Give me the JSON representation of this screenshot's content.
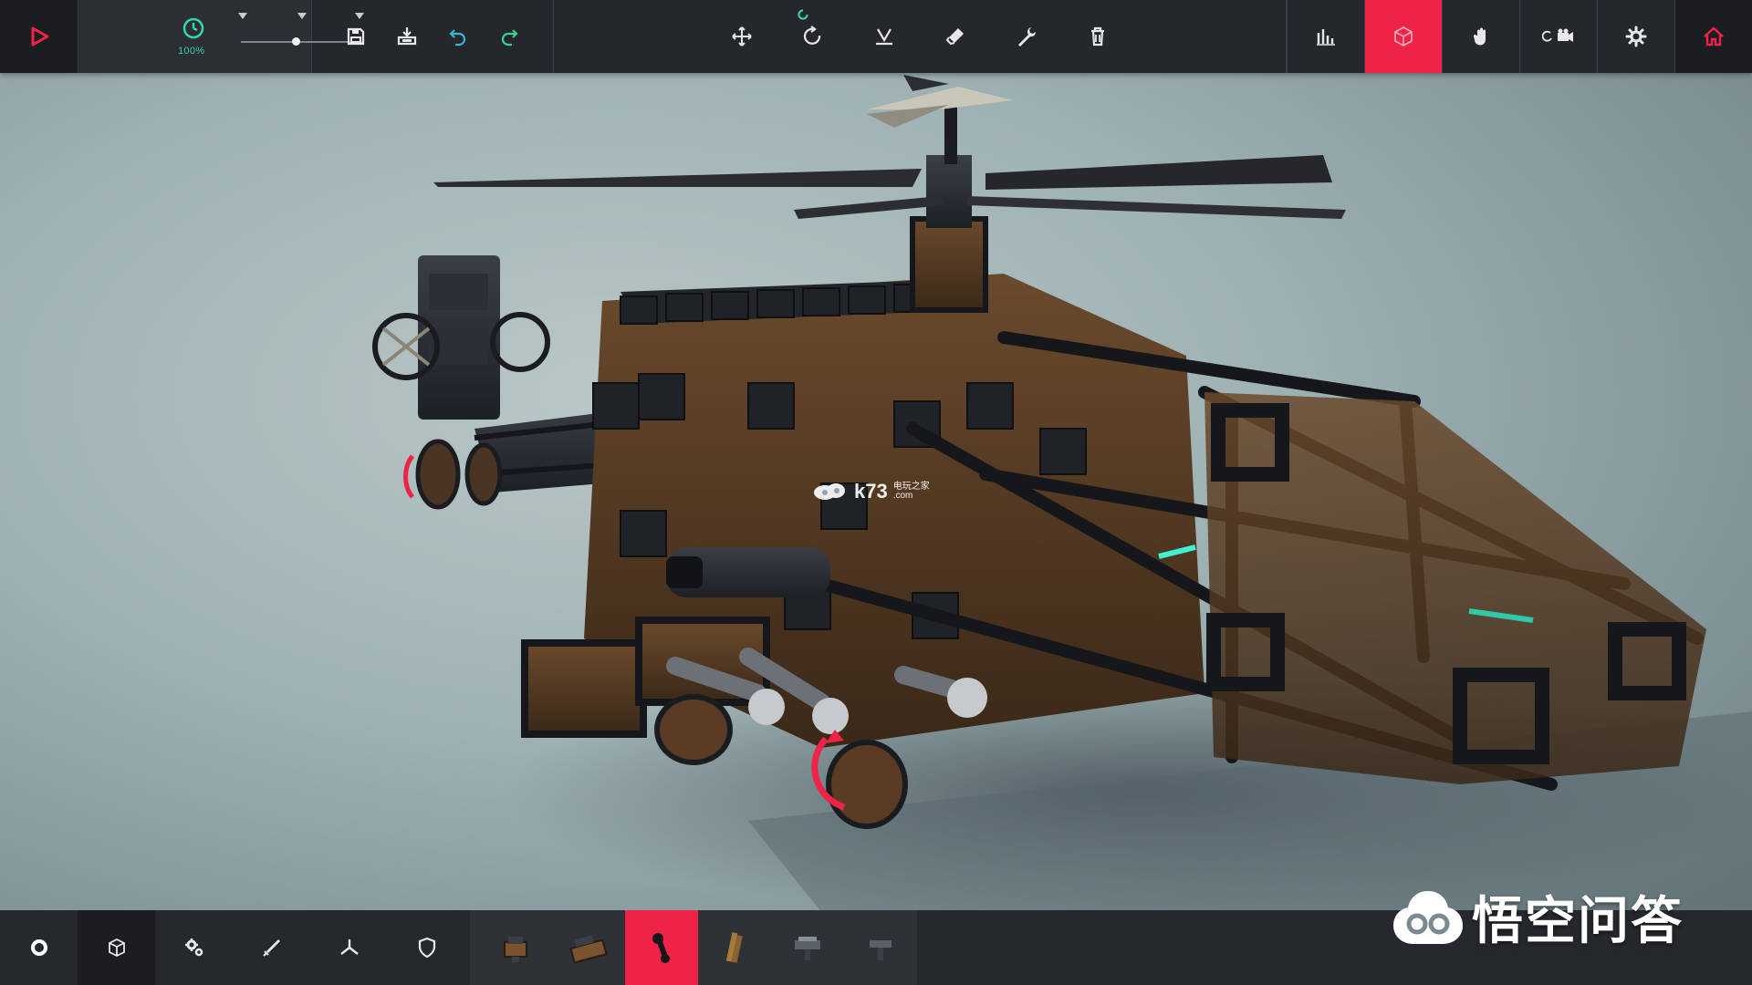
{
  "toolbar": {
    "time_scale": "100%",
    "time_slider_fraction": 0.45,
    "active_right_tool": "block-mode"
  },
  "watermark": {
    "text": "悟空问答",
    "site_text": "k73",
    "site_sub": "电玩之家",
    "site_domain": ".com"
  },
  "colors": {
    "accent": "#ee2347",
    "teal": "#35d3b4",
    "toolbar_bg": "#24272b"
  },
  "top_icons": [
    "play-icon",
    "timer-icon",
    "save-icon",
    "load-icon",
    "undo-icon",
    "redo-icon",
    "translate-icon",
    "rotate-icon",
    "mirror-icon",
    "eraser-icon",
    "wrench-icon",
    "trash-icon",
    "stats-icon",
    "block-mode-icon",
    "hand-icon",
    "camera-icon",
    "settings-icon",
    "home-icon"
  ],
  "bottom_categories": [
    "basic-blocks-icon",
    "cube-icon",
    "gears-icon",
    "weapon-icon",
    "flight-icon",
    "armour-icon"
  ],
  "active_block_index": 2
}
